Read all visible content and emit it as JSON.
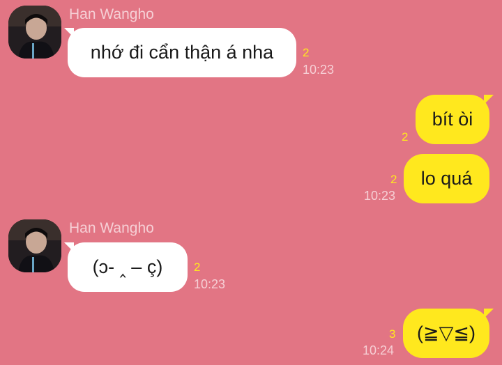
{
  "chat": {
    "colors": {
      "background": "#e27584",
      "incoming_bubble": "#ffffff",
      "outgoing_bubble": "#ffe81e",
      "unread_count": "#ffe81e",
      "meta_text": "#f6cfd5"
    },
    "messages": [
      {
        "direction": "incoming",
        "sender": "Han Wangho",
        "text": "nhớ đi cẩn thận á nha",
        "unread": "2",
        "time": "10:23"
      },
      {
        "direction": "outgoing",
        "text": "bít òi",
        "unread": "2",
        "time": ""
      },
      {
        "direction": "outgoing",
        "text": "lo quá",
        "unread": "2",
        "time": "10:23"
      },
      {
        "direction": "incoming",
        "sender": "Han Wangho",
        "text": "(ↄ- ‸ – ç)",
        "unread": "2",
        "time": "10:23"
      },
      {
        "direction": "outgoing",
        "text": "(≧▽≦)",
        "unread": "3",
        "time": "10:24"
      }
    ]
  }
}
